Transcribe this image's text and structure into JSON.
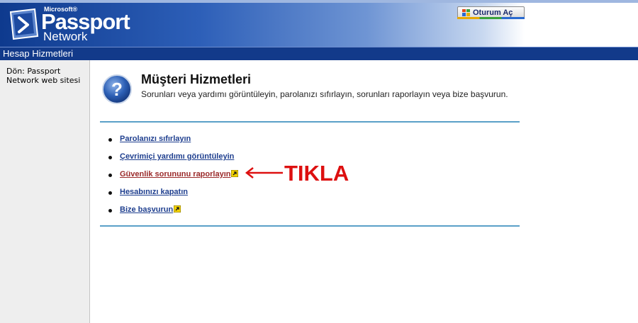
{
  "header": {
    "logo_small": "Microsoft®",
    "logo_main": "Passport",
    "logo_sub": "Network",
    "signin_label": "Oturum Aç",
    "signin_icon": "windows-flag-icon"
  },
  "titlebar": {
    "title": "Hesap Hizmetleri"
  },
  "sidebar": {
    "back_link": "Dön: Passport Network web sitesi"
  },
  "main": {
    "icon": "help-question-icon",
    "title": "Müşteri Hizmetleri",
    "description": "Sorunları veya yardımı görüntüleyin, parolanızı sıfırlayın, sorunları raporlayın veya bize başvurun.",
    "links": [
      {
        "label": "Parolanızı sıfırlayın",
        "external": false,
        "visited": false
      },
      {
        "label": "Çevrimiçi yardımı görüntüleyin",
        "external": false,
        "visited": false
      },
      {
        "label": "Güvenlik sorununu raporlayın",
        "external": true,
        "visited": true
      },
      {
        "label": "Hesabınızı kapatın",
        "external": false,
        "visited": false
      },
      {
        "label": "Bize başvurun",
        "external": true,
        "visited": false
      }
    ]
  },
  "annotation": {
    "text": "TIKLA",
    "color": "#dd1010"
  },
  "colors": {
    "header_blue": "#0e3a8e",
    "titlebar": "#123a8a",
    "link": "#1f3f8f",
    "visited_link": "#9a2a2a",
    "rule": "#5aa0c8"
  }
}
